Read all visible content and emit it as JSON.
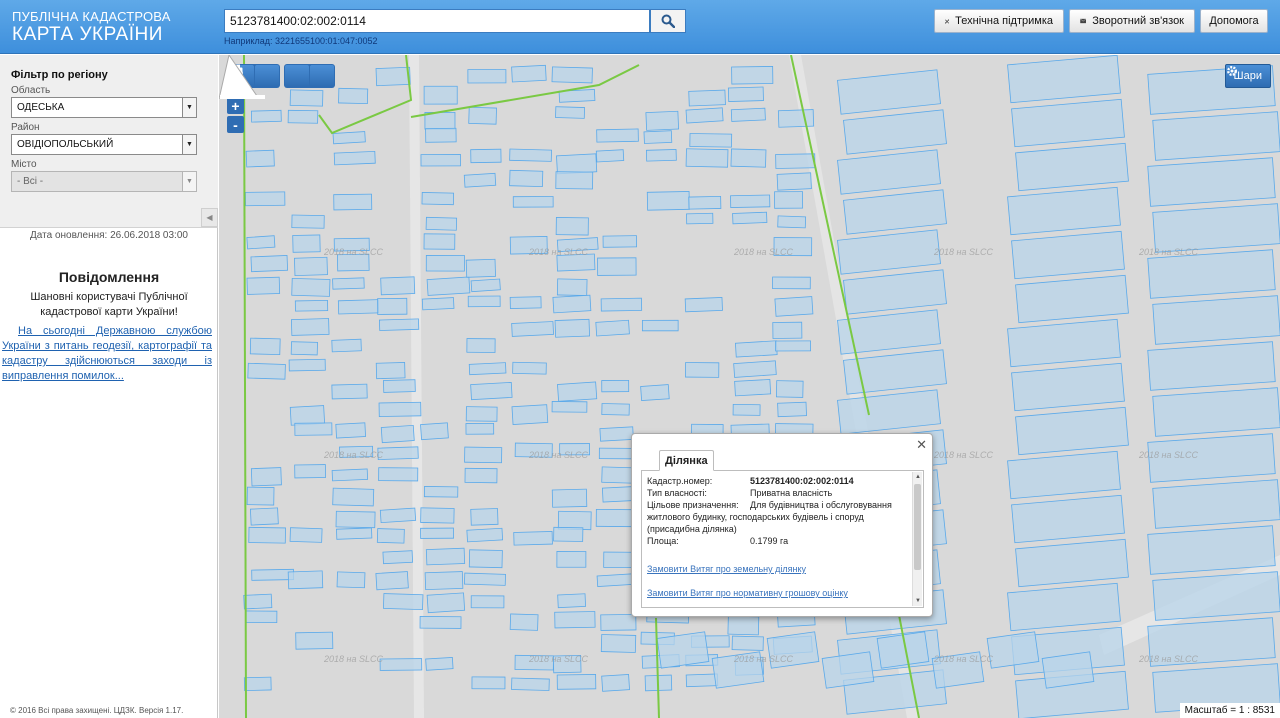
{
  "header": {
    "brand_line1": "ПУБЛІЧНА КАДАСТРОВА",
    "brand_line2": "КАРТА УКРАЇНИ",
    "search_value": "5123781400:02:002:0114",
    "search_hint": "Наприклад: 3221655100:01:047:0052",
    "support_label": "Технічна підтримка",
    "feedback_label": "Зворотний зв'язок",
    "help_label": "Допомога"
  },
  "sidebar": {
    "filter_title": "Фільтр по регіону",
    "oblast_label": "Область",
    "oblast_value": "ОДЕСЬКА",
    "rayon_label": "Район",
    "rayon_value": "ОВІДІОПОЛЬСЬКИЙ",
    "city_label": "Місто",
    "city_value": "- Всі -",
    "updated": "Дата оновлення: 26.06.2018 03:00",
    "news_title": "Повідомлення",
    "news_greeting": "Шановні користувачі Публічної кадастрової карти України!",
    "news_link": "На сьогодні Державною службою України з питань геодезії, картографії та кадастру здійснюються заходи із виправлення помилок...",
    "copyright": "© 2016 Всі права захищені. ЦДЗК. Версія 1.17."
  },
  "map": {
    "layers_label": "Шари",
    "zoom_in": "+",
    "zoom_out": "-",
    "scale": "Масштаб = 1 : 8531",
    "watermark": "2018 на SLCC"
  },
  "popup": {
    "tab": "Ділянка",
    "cadastral_label": "Кадастр.номер:",
    "cadastral_value": "5123781400:02:002:0114",
    "ownership_label": "Тип власності:",
    "ownership_value": "Приватна власність",
    "purpose_label": "Цільове призначення:",
    "purpose_value": "Для будівництва і обслуговування житлового будинку, господарських будівель і споруд (присадибна ділянка)",
    "area_label": "Площа:",
    "area_value": "0.1799 га",
    "link1": "Замовити Витяг про земельну ділянку",
    "link2": "Замовити Витяг про нормативну грошову оцінку"
  },
  "colors": {
    "header": "#4a9ae0",
    "parcel_fill": "#b8d4ea",
    "parcel_stroke": "#5aa9ea",
    "boundary": "#7ac943",
    "map_bg": "#d9d9d9"
  }
}
